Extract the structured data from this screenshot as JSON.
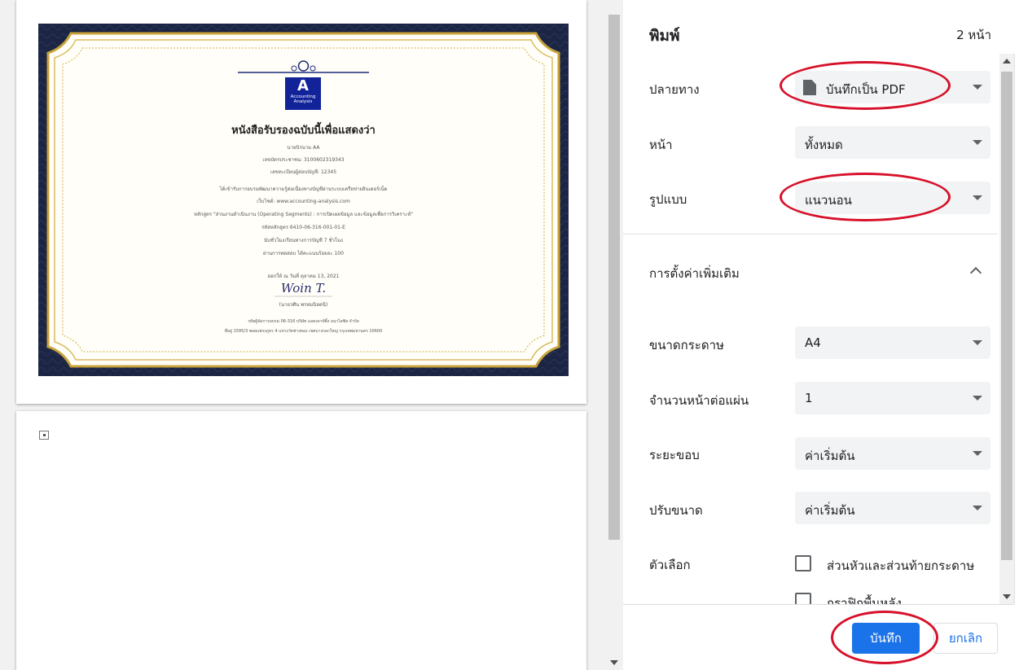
{
  "preview": {
    "certificate": {
      "logo_letter": "A",
      "logo_text_1": "Accounting",
      "logo_text_2": "Analysis",
      "title": "หนังสือรับรองฉบับนี้เพื่อแสดงว่า",
      "recipient": "นายนิรนาม AA",
      "id_number": "เลขบัตรประชาชน: 3100602319343",
      "registration": "เลขทะเบียนผู้สอบบัญชี: 12345",
      "line_training": "ได้เข้ารับการอบรมพัฒนาความรู้ต่อเนื่องทางบัญชีผ่านระบบเครือข่ายอินเตอร์เน็ต",
      "website": "เว็บไซต์: www.accounting-analysis.com",
      "course": "หลักสูตร \"ส่วนงานดำเนินงาน (Operating Segments) : การเปิดเผยข้อมูล และข้อมูลเพื่อการวิเคราะห์\"",
      "course_code": "รหัสหลักสูตร 6410-06-316-001-01-E",
      "hours": "นับชั่วโมงเรียนทางการบัญชี 7 ชั่วโมง",
      "score": "ผ่านการทดสอบ ได้คะแนนร้อยละ 100",
      "issued": "ออกให้ ณ วันที่ ตุลาคม 13, 2021",
      "signature": "Woin T.",
      "signer": "(นายวศิน พรหมนิลตนิ)",
      "org_line_1": "รหัสผู้จัดการอบรม 06-316 บริษัท แอคเคาท์ติ้ง อนาไลซิส จำกัด",
      "org_line_2": "ที่อยู่ 1595/3 ซอยแพรงภูธร 4 แขวงวัดช่างทอง เขตบางกอกใหญ่ กรุงเทพมหานคร 10600"
    }
  },
  "panel": {
    "title": "พิมพ์",
    "page_count": "2 หน้า",
    "destination": {
      "label": "ปลายทาง",
      "value": "บันทึกเป็น PDF",
      "icon": "pdf-file-icon"
    },
    "pages": {
      "label": "หน้า",
      "value": "ทั้งหมด"
    },
    "layout": {
      "label": "รูปแบบ",
      "value": "แนวนอน"
    },
    "more_settings": "การตั้งค่าเพิ่มเติม",
    "paper_size": {
      "label": "ขนาดกระดาษ",
      "value": "A4"
    },
    "pages_per_sheet": {
      "label": "จำนวนหน้าต่อแผ่น",
      "value": "1"
    },
    "margins": {
      "label": "ระยะขอบ",
      "value": "ค่าเริ่มต้น"
    },
    "scale": {
      "label": "ปรับขนาด",
      "value": "ค่าเริ่มต้น"
    },
    "options": {
      "label": "ตัวเลือก",
      "headers_footers": "ส่วนหัวและส่วนท้ายกระดาษ",
      "background_graphics": "กราฟิกพื้นหลัง"
    },
    "save_label": "บันทึก",
    "cancel_label": "ยกเลิก"
  },
  "colors": {
    "accent": "#1a73e8",
    "annotation": "#d7112a",
    "certificate_border": "#1c2543",
    "certificate_gold": "#c9a33a"
  }
}
